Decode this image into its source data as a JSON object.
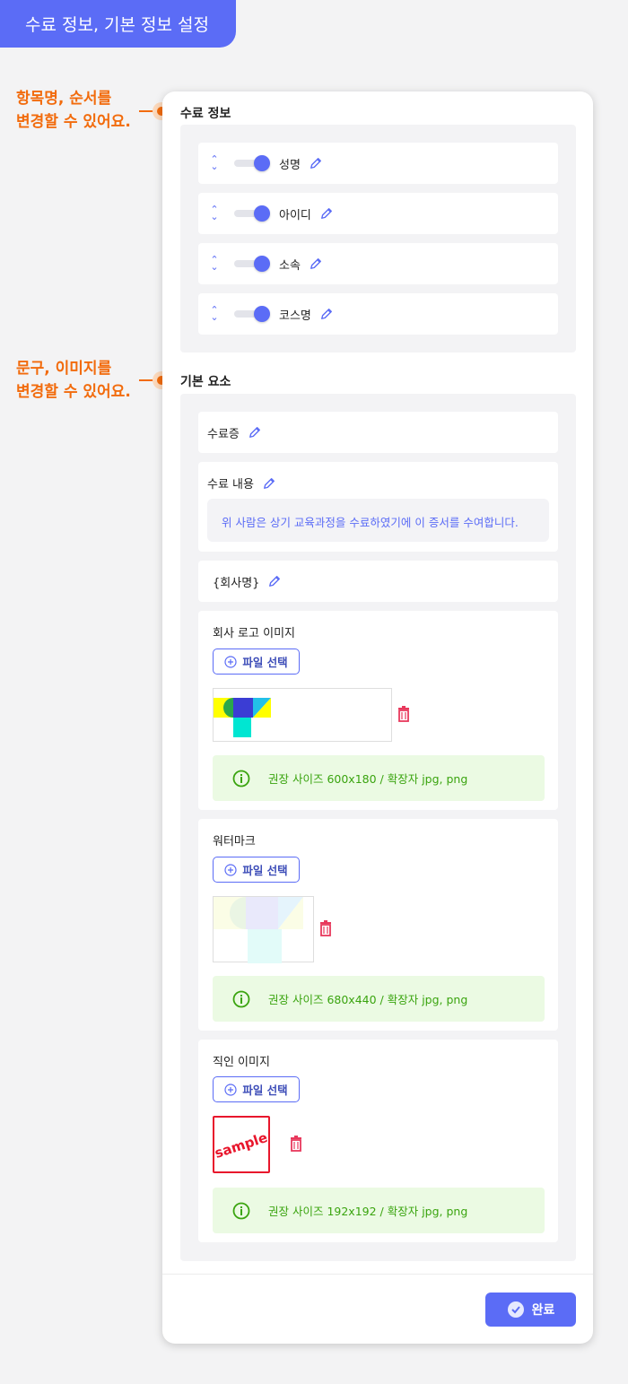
{
  "header": {
    "title": "수료 정보, 기본 정보 설정"
  },
  "callouts": [
    {
      "line1": "항목명, 순서를",
      "line2": "변경할 수 있어요."
    },
    {
      "line1": "문구, 이미지를",
      "line2": "변경할 수 있어요."
    }
  ],
  "completion_info": {
    "title": "수료 정보",
    "fields": [
      {
        "label": "성명",
        "enabled": true
      },
      {
        "label": "아이디",
        "enabled": true
      },
      {
        "label": "소속",
        "enabled": true
      },
      {
        "label": "코스명",
        "enabled": true
      }
    ]
  },
  "basic_elements": {
    "title": "기본 요소",
    "certificate_label": "수료증",
    "content_label": "수료 내용",
    "content_text": "위 사람은 상기 교육과정을 수료하였기에 이 증서를 수여합니다.",
    "company_label": "{회사명}",
    "logo": {
      "label": "회사 로고 이미지",
      "button": "파일 선택",
      "info": "권장 사이즈 600x180 / 확장자 jpg, png"
    },
    "watermark": {
      "label": "워터마크",
      "button": "파일 선택",
      "info": "권장 사이즈 680x440 / 확장자 jpg, png"
    },
    "seal": {
      "label": "직인 이미지",
      "button": "파일 선택",
      "info": "권장 사이즈 192x192 / 확장자 jpg, png",
      "sample_text": "sample"
    }
  },
  "footer": {
    "done_label": "완료"
  },
  "colors": {
    "accent": "#5b6cf6",
    "callout": "#f26b0c",
    "info_text": "#3aa40f",
    "danger": "#e8385c"
  }
}
